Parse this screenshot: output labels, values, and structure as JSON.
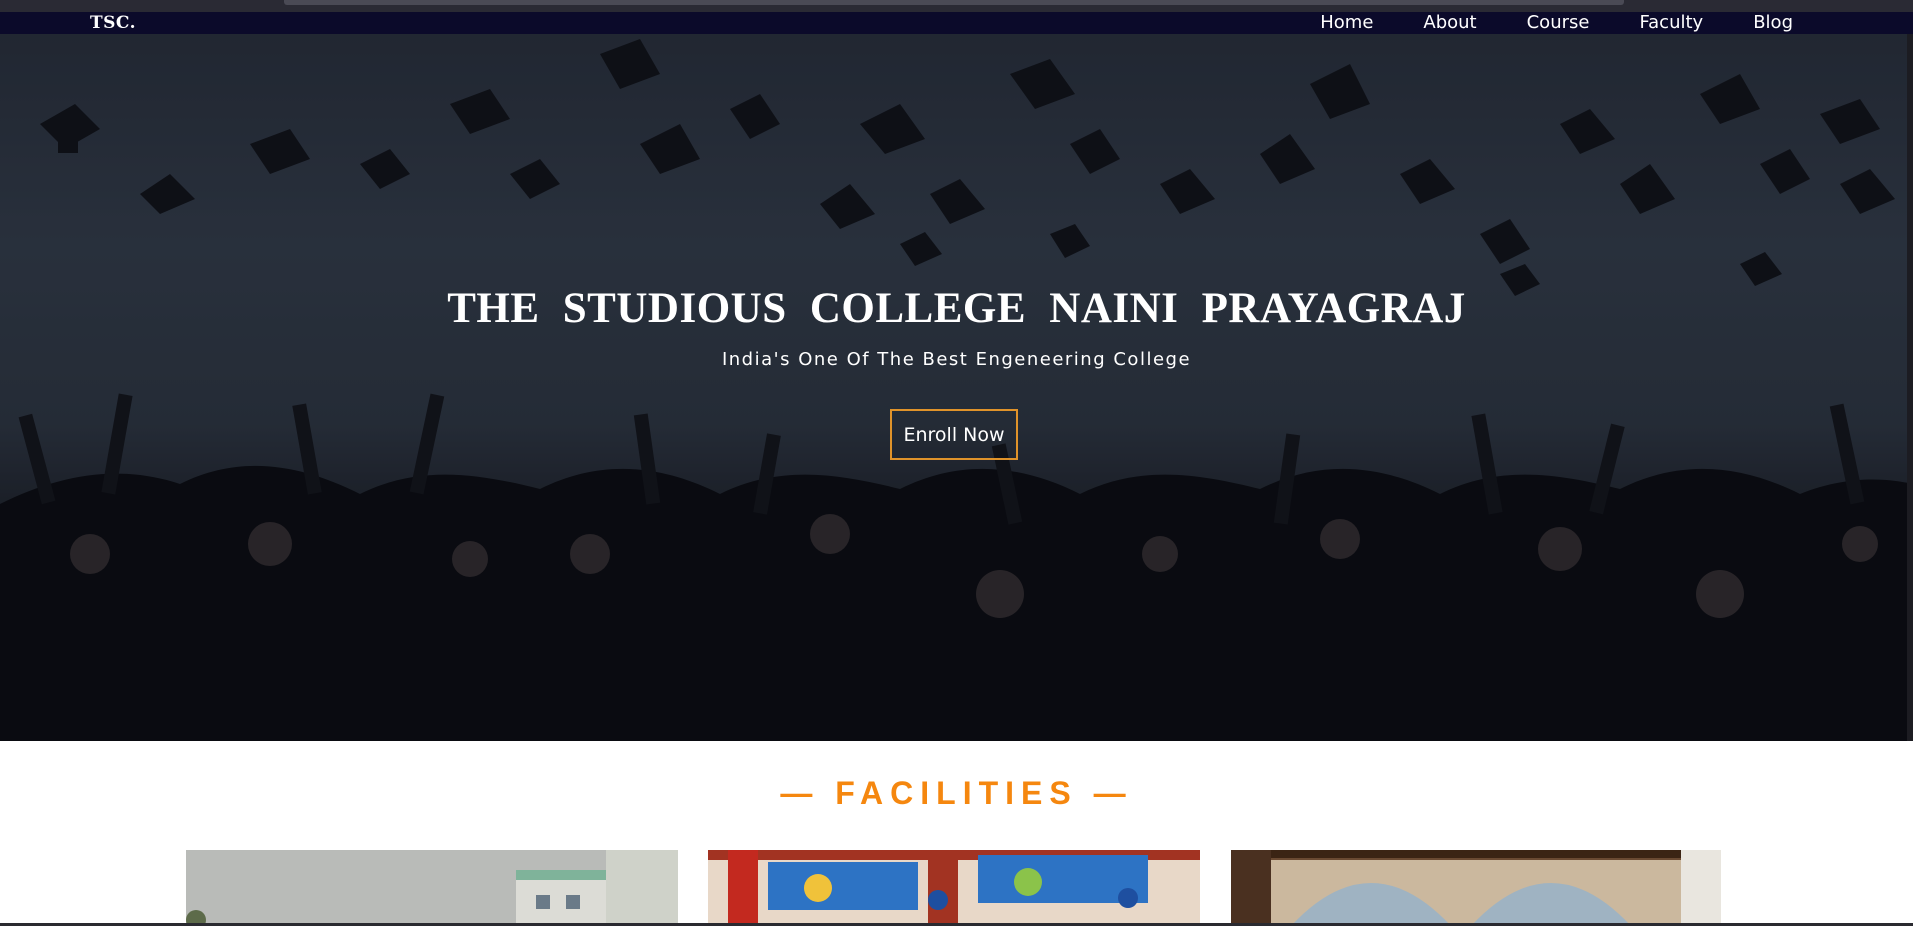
{
  "navbar": {
    "logo": "TSC.",
    "links": [
      "Home",
      "About",
      "Course",
      "Faculty",
      "Blog"
    ]
  },
  "hero": {
    "title": "THE STUDIOUS COLLEGE NAINI PRAYAGRAJ",
    "subtitle": "India's One Of The Best Engeneering College",
    "button_label": "Enroll Now"
  },
  "facilities": {
    "heading": "— FACILITIES —"
  },
  "colors": {
    "accent": "#f5870f",
    "button_border": "#e0932a",
    "navbar": "#0b0a2a"
  }
}
